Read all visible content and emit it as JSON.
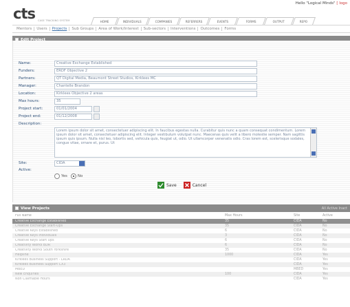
{
  "header": {
    "greeting": "Hello \"Logical Minds\"",
    "logout": "[ logo",
    "logo": "cts",
    "logo_sub": "CASE TRACKING SYSTEM"
  },
  "nav": {
    "tabs": [
      "HOME",
      "INDIVIDUALS",
      "COMPANIES",
      "REFERRERS",
      "EVENTS",
      "FORMS",
      "OUTPUT",
      "REPO"
    ]
  },
  "subnav": {
    "items": [
      "Mentors",
      "Users",
      "Projects",
      "Sub Groups",
      "Area of Work/Interest",
      "Sub-sectors",
      "Interventions",
      "Outcomes",
      "Forms"
    ],
    "active": "Projects"
  },
  "edit": {
    "title": "Edit Project",
    "fields": {
      "name_label": "Name:",
      "name_value": "Creative Exchange Established",
      "funders_label": "Funders:",
      "funders_value": "ERDF Objective 2",
      "partners_label": "Partners:",
      "partners_value": "QT Digital Media, Beaumont Street Studios, Kirklees MC",
      "manager_label": "Manager:",
      "manager_value": "Chantelle Brandon",
      "location_label": "Location:",
      "location_value": "Kirklees Objective 2 areas",
      "maxhours_label": "Max hours:",
      "maxhours_value": "35",
      "start_label": "Project start:",
      "start_value": "01/01/2004",
      "end_label": "Project end:",
      "end_value": "01/12/2008",
      "desc_label": "Description:",
      "desc_value": "Lorem ipsum dolor sit amet, consectetuer adipiscing elit. In faucibus egestas nulla. Curabitur quis nunc a quam consequat condimentum. Lorem ipsum dolor sit amet, consectetuer adipiscing elit. Integer vestibulum volutpat nunc. Maecenas quis velit a libero molestie semper. Nam sagittis ipsum quis ipsum. Nulla nisl leo, lobortis sed, vehicula quis, feugiat ut, odio. Ut ullamcorper venenatis odio. Cras lorem est, scelerisque sodales, congue vitae, ornare et, purus. Ut",
      "site_label": "Site:",
      "site_value": "CIDA",
      "active_label": "Active:",
      "yes_label": "Yes",
      "no_label": "No",
      "active_selected": "No"
    },
    "save_label": "Save",
    "cancel_label": "Cancel"
  },
  "view": {
    "title": "View Projects",
    "filter_text": "All  Active  Inact",
    "columns": [
      "Full Name",
      "Max Hours",
      "Site",
      "Active"
    ],
    "rows": [
      {
        "name": "Creative Exchange Established",
        "hours": "35",
        "site": "CIDA",
        "active": "No"
      },
      {
        "name": "Creative Exchange Start-Ups",
        "hours": "35",
        "site": "CIDA",
        "active": "No"
      },
      {
        "name": "Creative Keys Established",
        "hours": "6",
        "site": "CIDA",
        "active": "No"
      },
      {
        "name": "Creative Keys Individuals",
        "hours": "3",
        "site": "CIDA",
        "active": "No"
      },
      {
        "name": "Creative Keys Start Ups",
        "hours": "6",
        "site": "CIDA",
        "active": "No"
      },
      {
        "name": "Creativity Works BDR",
        "hours": "6",
        "site": "CIDA",
        "active": "No"
      },
      {
        "name": "Creativity Works South Yorkshire",
        "hours": "35",
        "site": "CIDA",
        "active": "No"
      },
      {
        "name": "Helpline",
        "hours": "1000",
        "site": "CIDA",
        "active": "Yes"
      },
      {
        "name": "Kirklees Business Support - LRDA",
        "hours": "",
        "site": "CIDA",
        "active": "Yes"
      },
      {
        "name": "Kirklees Business Support CX3",
        "hours": "",
        "site": "CIDA",
        "active": "Yes"
      },
      {
        "name": "MBED",
        "hours": "",
        "site": "MBED",
        "active": "Yes"
      },
      {
        "name": "New Enquiries",
        "hours": "100",
        "site": "CIDA",
        "active": "Yes"
      },
      {
        "name": "Non Claimable Hours",
        "hours": "",
        "site": "CIDA",
        "active": "Yes"
      }
    ]
  },
  "colors": {
    "header_bar": "#8a8a8a",
    "label_blue": "#2d4f78",
    "save_green": "#2e8b2e",
    "cancel_red": "#cc2222",
    "selected_row": "#8f8f8f"
  }
}
